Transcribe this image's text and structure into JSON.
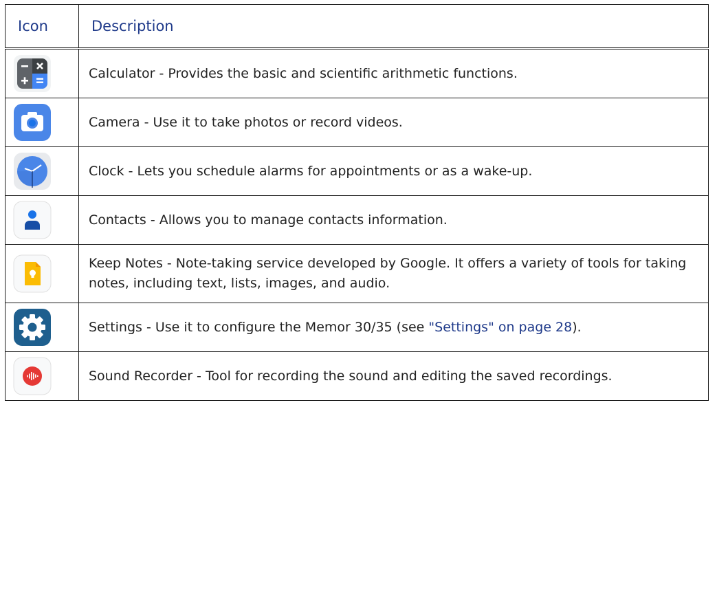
{
  "table": {
    "headers": {
      "icon": "Icon",
      "description": "Description"
    },
    "rows": [
      {
        "icon_name": "calculator-icon",
        "text": "Calculator - Provides the basic and scientific arithmetic functions."
      },
      {
        "icon_name": "camera-icon",
        "text": "Camera - Use it to take photos or record videos."
      },
      {
        "icon_name": "clock-icon",
        "text": "Clock - Lets you schedule alarms for appointments or as a wake-up."
      },
      {
        "icon_name": "contacts-icon",
        "text": "Contacts - Allows you to manage contacts information."
      },
      {
        "icon_name": "keep-notes-icon",
        "text": "Keep Notes - Note-taking service developed by Google. It offers a variety of tools for taking notes, including text, lists, images, and audio."
      },
      {
        "icon_name": "settings-icon",
        "text_before": "Settings - Use it to configure the Memor 30/35 (see ",
        "link": "\"Settings\" on page 28",
        "text_after": ")."
      },
      {
        "icon_name": "sound-recorder-icon",
        "text": "Sound Recorder - Tool for recording the sound and editing the saved recordings."
      }
    ]
  },
  "colors": {
    "header_text": "#1f3a8a",
    "link": "#1f3a8a",
    "body_text": "#222222",
    "border": "#1a1a1a"
  }
}
